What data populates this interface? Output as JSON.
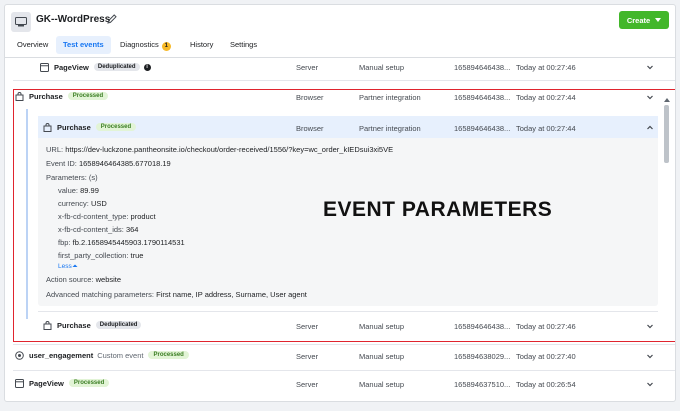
{
  "header": {
    "title": "GK--WordPress",
    "create_label": "Create"
  },
  "tabs": [
    {
      "label": "Overview"
    },
    {
      "label": "Test events"
    },
    {
      "label": "Diagnostics",
      "badge": "1"
    },
    {
      "label": "History"
    },
    {
      "label": "Settings"
    }
  ],
  "rows": {
    "r0": {
      "name": "PageView",
      "status": "Deduplicated",
      "source": "Server",
      "setup": "Manual setup",
      "id": "165894646438...",
      "time": "Today at 00:27:46"
    },
    "r1": {
      "name": "Purchase",
      "status": "Processed",
      "source": "Browser",
      "setup": "Partner integration",
      "id": "165894646438...",
      "time": "Today at 00:27:44"
    },
    "r2": {
      "name": "Purchase",
      "status": "Processed",
      "source": "Browser",
      "setup": "Partner integration",
      "id": "165894646438...",
      "time": "Today at 00:27:44"
    },
    "r3": {
      "name": "Purchase",
      "status": "Deduplicated",
      "source": "Server",
      "setup": "Manual setup",
      "id": "165894646438...",
      "time": "Today at 00:27:46"
    },
    "r4": {
      "name": "user_engagement",
      "custom": "Custom event",
      "status": "Processed",
      "source": "Server",
      "setup": "Manual setup",
      "id": "165894638029...",
      "time": "Today at 00:27:40"
    },
    "r5": {
      "name": "PageView",
      "status": "Processed",
      "source": "Server",
      "setup": "Manual setup",
      "id": "165894637510...",
      "time": "Today at 00:26:54"
    }
  },
  "details": {
    "url_label": "URL:",
    "url": "https://dev-luckzone.pantheonsite.io/checkout/order-received/1556/?key=wc_order_kIEDsui3xi5VE",
    "event_id_label": "Event ID:",
    "event_id": "1658946464385.677018.19",
    "params_label": "Parameters: (s)",
    "params": [
      {
        "k": "value:",
        "v": "89.99"
      },
      {
        "k": "currency:",
        "v": "USD"
      },
      {
        "k": "x-fb-cd-content_type:",
        "v": "product"
      },
      {
        "k": "x-fb-cd-content_ids:",
        "v": "364"
      },
      {
        "k": "fbp:",
        "v": "fb.2.1658945445903.1790114531"
      },
      {
        "k": "first_party_collection:",
        "v": "true"
      }
    ],
    "less_label": "Less",
    "action_source_label": "Action source:",
    "action_source": "website",
    "amp_label": "Advanced matching parameters:",
    "amp": "First name, IP address, Surname, User agent"
  },
  "overlay": "EVENT PARAMETERS",
  "colors": {
    "accent": "#1877f2",
    "create": "#42b72a",
    "highlight": "#e0242e",
    "processed": "#e2f4d6"
  }
}
